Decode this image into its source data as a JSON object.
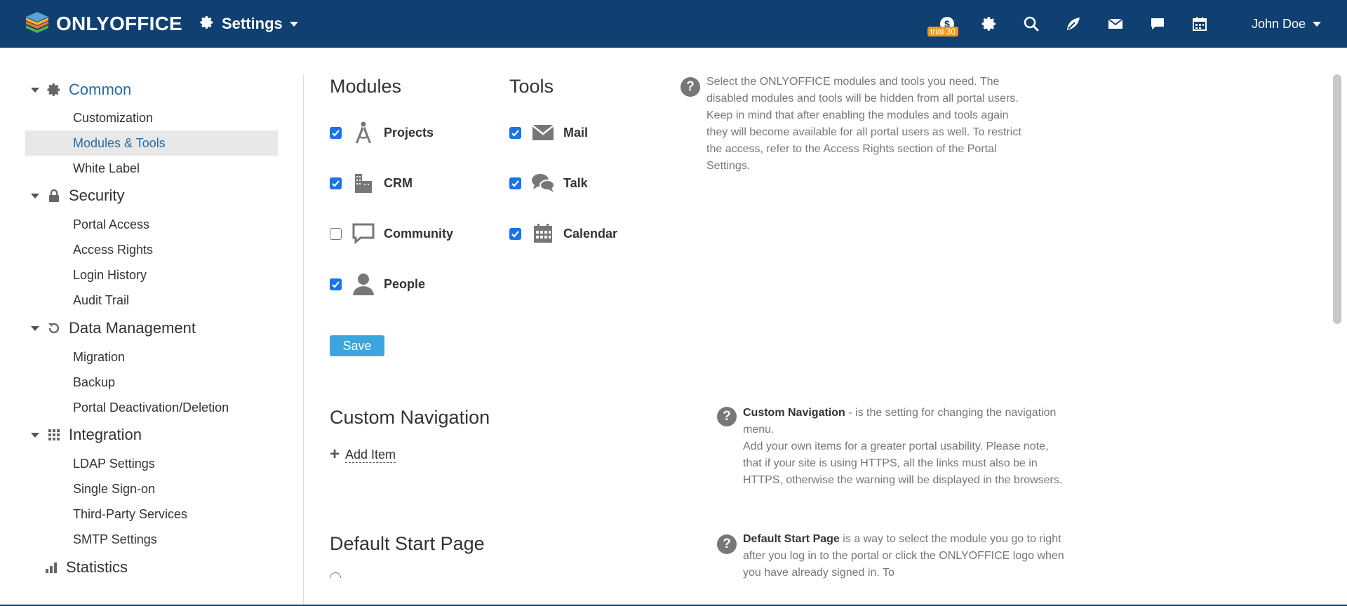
{
  "topbar": {
    "logo_text": "ONLYOFFICE",
    "module_label": "Settings",
    "trial_badge": "trial 30",
    "user_name": "John Doe",
    "icons": [
      "payments-icon",
      "gear-icon",
      "search-icon",
      "feed-icon",
      "mail-icon",
      "talk-icon",
      "calendar-icon"
    ]
  },
  "sidebar": {
    "groups": [
      {
        "label": "Common",
        "icon": "gear-icon",
        "items": [
          "Customization",
          "Modules & Tools",
          "White Label"
        ]
      },
      {
        "label": "Security",
        "icon": "lock-icon",
        "items": [
          "Portal Access",
          "Access Rights",
          "Login History",
          "Audit Trail"
        ]
      },
      {
        "label": "Data Management",
        "icon": "restore-icon",
        "items": [
          "Migration",
          "Backup",
          "Portal Deactivation/Deletion"
        ]
      },
      {
        "label": "Integration",
        "icon": "grid-icon",
        "items": [
          "LDAP Settings",
          "Single Sign-on",
          "Third-Party Services",
          "SMTP Settings"
        ]
      },
      {
        "label": "Statistics",
        "icon": "bar-chart-icon",
        "items": []
      }
    ],
    "selected_item": "Modules & Tools"
  },
  "modules": {
    "title": "Modules",
    "items": [
      {
        "label": "Projects",
        "checked": true,
        "icon": "projects-icon"
      },
      {
        "label": "CRM",
        "checked": true,
        "icon": "crm-icon"
      },
      {
        "label": "Community",
        "checked": false,
        "icon": "community-icon"
      },
      {
        "label": "People",
        "checked": true,
        "icon": "people-icon"
      }
    ]
  },
  "tools": {
    "title": "Tools",
    "items": [
      {
        "label": "Mail",
        "checked": true,
        "icon": "mail-icon"
      },
      {
        "label": "Talk",
        "checked": true,
        "icon": "talk-icon"
      },
      {
        "label": "Calendar",
        "checked": true,
        "icon": "calendar-icon"
      }
    ]
  },
  "save_label": "Save",
  "help": {
    "modules_text": "Select the ONLYOFFICE modules and tools you need. The disabled modules and tools will be hidden from all portal users. Keep in mind that after enabling the modules and tools again they will become available for all portal users as well. To restrict the access, refer to the Access Rights section of the Portal Settings.",
    "nav_bold": "Custom Navigation",
    "nav_text": " - is the setting for changing the navigation menu.",
    "nav_text2": "Add your own items for a greater portal usability. Please note, that if your site is using HTTPS, all the links must also be in HTTPS, otherwise the warning will be displayed in the browsers.",
    "start_bold": "Default Start Page",
    "start_text": " is a way to select the module you go to right after you log in to the portal or click the ONLYOFFICE logo when you have already signed in. To"
  },
  "custom_navigation": {
    "title": "Custom Navigation",
    "add_item_label": "Add Item"
  },
  "default_start_page": {
    "title": "Default Start Page"
  },
  "colors": {
    "topbar": "#0f4071",
    "accent": "#2c6aa7",
    "save": "#3da5de",
    "trial": "#f29a1c"
  }
}
